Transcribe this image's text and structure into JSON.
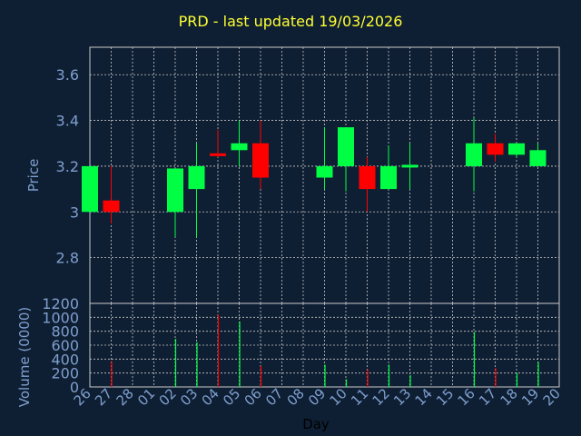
{
  "title": "PRD - last updated 19/03/2026",
  "colors": {
    "background": "#0f1f33",
    "title": "#ffff33",
    "axis_text": "#7f9fcf",
    "up": "#00ff44",
    "down": "#ff0000",
    "grid": "#c8c8c8"
  },
  "chart_data": [
    {
      "type": "candlestick",
      "ylabel": "Price",
      "ylim": [
        2.6,
        3.72
      ],
      "yticks": [
        2.8,
        3,
        3.2,
        3.4,
        3.6
      ],
      "ytick_labels": [
        "2.8",
        "3",
        "3.2",
        "3.4",
        "3.6"
      ],
      "grid": true,
      "days": [
        "26",
        "27",
        "28",
        "01",
        "02",
        "03",
        "04",
        "05",
        "06",
        "07",
        "08",
        "09",
        "10",
        "11",
        "12",
        "13",
        "14",
        "15",
        "16",
        "17",
        "18",
        "19",
        "20"
      ],
      "candles": [
        {
          "day": "26",
          "open": 3.0,
          "close": 3.2,
          "high": 3.2,
          "low": 3.0
        },
        {
          "day": "27",
          "open": 3.05,
          "close": 3.0,
          "high": 3.2,
          "low": 2.95
        },
        {
          "day": "02",
          "open": 3.0,
          "close": 3.19,
          "high": 3.19,
          "low": 2.89
        },
        {
          "day": "03",
          "open": 3.1,
          "close": 3.2,
          "high": 3.3,
          "low": 2.89
        },
        {
          "day": "04",
          "open": 3.25,
          "close": 3.24,
          "high": 3.36,
          "low": 3.24
        },
        {
          "day": "05",
          "open": 3.27,
          "close": 3.3,
          "high": 3.4,
          "low": 3.2
        },
        {
          "day": "06",
          "open": 3.3,
          "close": 3.15,
          "high": 3.4,
          "low": 3.1
        },
        {
          "day": "09",
          "open": 3.15,
          "close": 3.2,
          "high": 3.37,
          "low": 3.1
        },
        {
          "day": "10",
          "open": 3.2,
          "close": 3.37,
          "high": 3.37,
          "low": 3.09
        },
        {
          "day": "11",
          "open": 3.2,
          "close": 3.1,
          "high": 3.24,
          "low": 3.0
        },
        {
          "day": "12",
          "open": 3.1,
          "close": 3.2,
          "high": 3.29,
          "low": 3.1
        },
        {
          "day": "13",
          "open": 3.2,
          "close": 3.2,
          "high": 3.3,
          "low": 3.1
        },
        {
          "day": "16",
          "open": 3.2,
          "close": 3.3,
          "high": 3.41,
          "low": 3.09
        },
        {
          "day": "17",
          "open": 3.3,
          "close": 3.25,
          "high": 3.34,
          "low": 3.22
        },
        {
          "day": "18",
          "open": 3.25,
          "close": 3.3,
          "high": 3.3,
          "low": 3.24
        },
        {
          "day": "19",
          "open": 3.2,
          "close": 3.27,
          "high": 3.3,
          "low": 3.2
        }
      ]
    },
    {
      "type": "bar",
      "xlabel": "Day",
      "ylabel": "Volume (0000)",
      "ylim": [
        0,
        1200
      ],
      "yticks": [
        0,
        200,
        400,
        600,
        800,
        1000,
        1200
      ],
      "ytick_labels": [
        "0",
        "200",
        "400",
        "600",
        "800",
        "1000",
        "1200"
      ],
      "grid": true,
      "volumes": [
        {
          "day": "27",
          "value": 370,
          "direction": "down"
        },
        {
          "day": "02",
          "value": 690,
          "direction": "up"
        },
        {
          "day": "03",
          "value": 640,
          "direction": "up"
        },
        {
          "day": "04",
          "value": 1040,
          "direction": "down"
        },
        {
          "day": "05",
          "value": 940,
          "direction": "up"
        },
        {
          "day": "06",
          "value": 300,
          "direction": "down"
        },
        {
          "day": "09",
          "value": 320,
          "direction": "up"
        },
        {
          "day": "10",
          "value": 110,
          "direction": "up"
        },
        {
          "day": "11",
          "value": 250,
          "direction": "down"
        },
        {
          "day": "12",
          "value": 320,
          "direction": "up"
        },
        {
          "day": "13",
          "value": 170,
          "direction": "up"
        },
        {
          "day": "16",
          "value": 790,
          "direction": "up"
        },
        {
          "day": "17",
          "value": 270,
          "direction": "down"
        },
        {
          "day": "18",
          "value": 200,
          "direction": "up"
        },
        {
          "day": "19",
          "value": 360,
          "direction": "up"
        }
      ]
    }
  ]
}
